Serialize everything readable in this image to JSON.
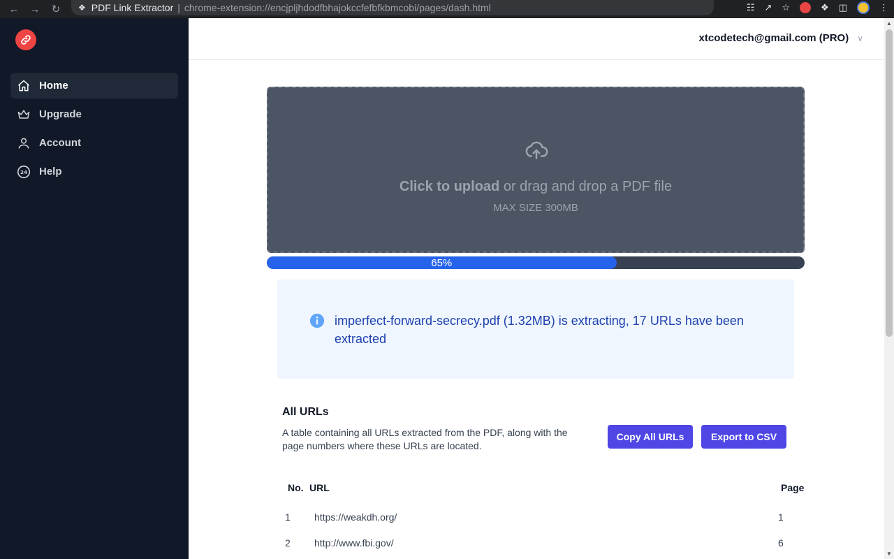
{
  "browser": {
    "extension_name": "PDF Link Extractor",
    "separator": "|",
    "url": "chrome-extension://encjpljhdodfbhajokccfefbfkbmcobi/pages/dash.html",
    "nav_icons": [
      "back-icon",
      "forward-icon",
      "reload-icon"
    ],
    "toolbar_icons": [
      "translate-icon",
      "share-icon",
      "bookmark-star-icon",
      "pdf-link-extension-icon",
      "extensions-puzzle-icon",
      "side-panel-icon",
      "profile-avatar-icon",
      "chrome-menu-icon"
    ]
  },
  "sidebar": {
    "logo_icon": "link-icon",
    "items": [
      {
        "label": "Home",
        "icon": "home-icon",
        "active": true
      },
      {
        "label": "Upgrade",
        "icon": "crown-icon",
        "active": false
      },
      {
        "label": "Account",
        "icon": "user-icon",
        "active": false
      },
      {
        "label": "Help",
        "icon": "support-24-icon",
        "active": false
      }
    ]
  },
  "header": {
    "user": "xtcodetech@gmail.com (PRO)"
  },
  "upload": {
    "click_text": "Click to upload",
    "rest_text": " or drag and drop a PDF file",
    "max_size": "MAX SIZE 300MB"
  },
  "progress": {
    "percent": 65,
    "label": "65%"
  },
  "alert": {
    "message": "imperfect-forward-secrecy.pdf (1.32MB) is extracting, 17 URLs have been extracted"
  },
  "urls": {
    "title": "All URLs",
    "description": "A table containing all URLs extracted from the PDF, along with the page numbers where these URLs are located.",
    "copy_button": "Copy All URLs",
    "export_button": "Export to CSV",
    "columns": {
      "no": "No.",
      "url": "URL",
      "page": "Page"
    },
    "rows": [
      {
        "no": "1",
        "url": "https://weakdh.org/",
        "page": "1"
      },
      {
        "no": "2",
        "url": "http://www.fbi.gov/",
        "page": "6"
      }
    ]
  },
  "colors": {
    "sidebar_bg": "#111827",
    "accent": "#4f46e5",
    "progress_fill": "#2563eb",
    "alert_bg": "#eff6ff",
    "alert_text": "#1e40af",
    "logo": "#ef4444"
  }
}
